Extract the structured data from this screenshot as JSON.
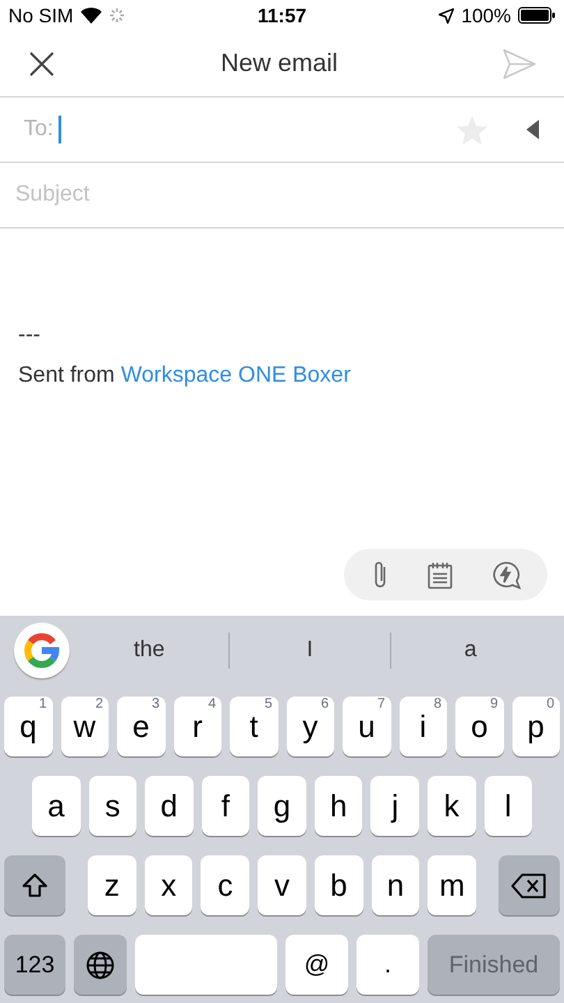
{
  "status_bar": {
    "carrier": "No SIM",
    "time": "11:57",
    "battery": "100%"
  },
  "header": {
    "title": "New email"
  },
  "to_field": {
    "label": "To:",
    "focused": true
  },
  "subject_field": {
    "placeholder": "Subject"
  },
  "body": {
    "separator": "---",
    "signature_prefix": "Sent from",
    "signature_link": "Workspace ONE Boxer"
  },
  "suggestions": [
    "the",
    "I",
    "a"
  ],
  "keyboard": {
    "rows": [
      {
        "keys": [
          {
            "kind": "letter",
            "label": "q",
            "hint": "1"
          },
          {
            "kind": "letter",
            "label": "w",
            "hint": "2"
          },
          {
            "kind": "letter",
            "label": "e",
            "hint": "3"
          },
          {
            "kind": "letter",
            "label": "r",
            "hint": "4"
          },
          {
            "kind": "letter",
            "label": "t",
            "hint": "5"
          },
          {
            "kind": "letter",
            "label": "y",
            "hint": "6"
          },
          {
            "kind": "letter",
            "label": "u",
            "hint": "7"
          },
          {
            "kind": "letter",
            "label": "i",
            "hint": "8"
          },
          {
            "kind": "letter",
            "label": "o",
            "hint": "9"
          },
          {
            "kind": "letter",
            "label": "p",
            "hint": "0"
          }
        ]
      },
      {
        "keys": [
          {
            "kind": "letter",
            "label": "a"
          },
          {
            "kind": "letter",
            "label": "s"
          },
          {
            "kind": "letter",
            "label": "d"
          },
          {
            "kind": "letter",
            "label": "f"
          },
          {
            "kind": "letter",
            "label": "g"
          },
          {
            "kind": "letter",
            "label": "h"
          },
          {
            "kind": "letter",
            "label": "j"
          },
          {
            "kind": "letter",
            "label": "k"
          },
          {
            "kind": "letter",
            "label": "l"
          }
        ]
      },
      {
        "keys": [
          {
            "kind": "shift"
          },
          {
            "kind": "letter",
            "label": "z"
          },
          {
            "kind": "letter",
            "label": "x"
          },
          {
            "kind": "letter",
            "label": "c"
          },
          {
            "kind": "letter",
            "label": "v"
          },
          {
            "kind": "letter",
            "label": "b"
          },
          {
            "kind": "letter",
            "label": "n"
          },
          {
            "kind": "letter",
            "label": "m"
          },
          {
            "kind": "backspace"
          }
        ]
      },
      {
        "keys": [
          {
            "kind": "mode",
            "label": "123"
          },
          {
            "kind": "globe"
          },
          {
            "kind": "space"
          },
          {
            "kind": "symbol",
            "label": "@"
          },
          {
            "kind": "symbol",
            "label": "."
          },
          {
            "kind": "return",
            "label": "Finished",
            "disabled": true
          }
        ]
      }
    ]
  }
}
